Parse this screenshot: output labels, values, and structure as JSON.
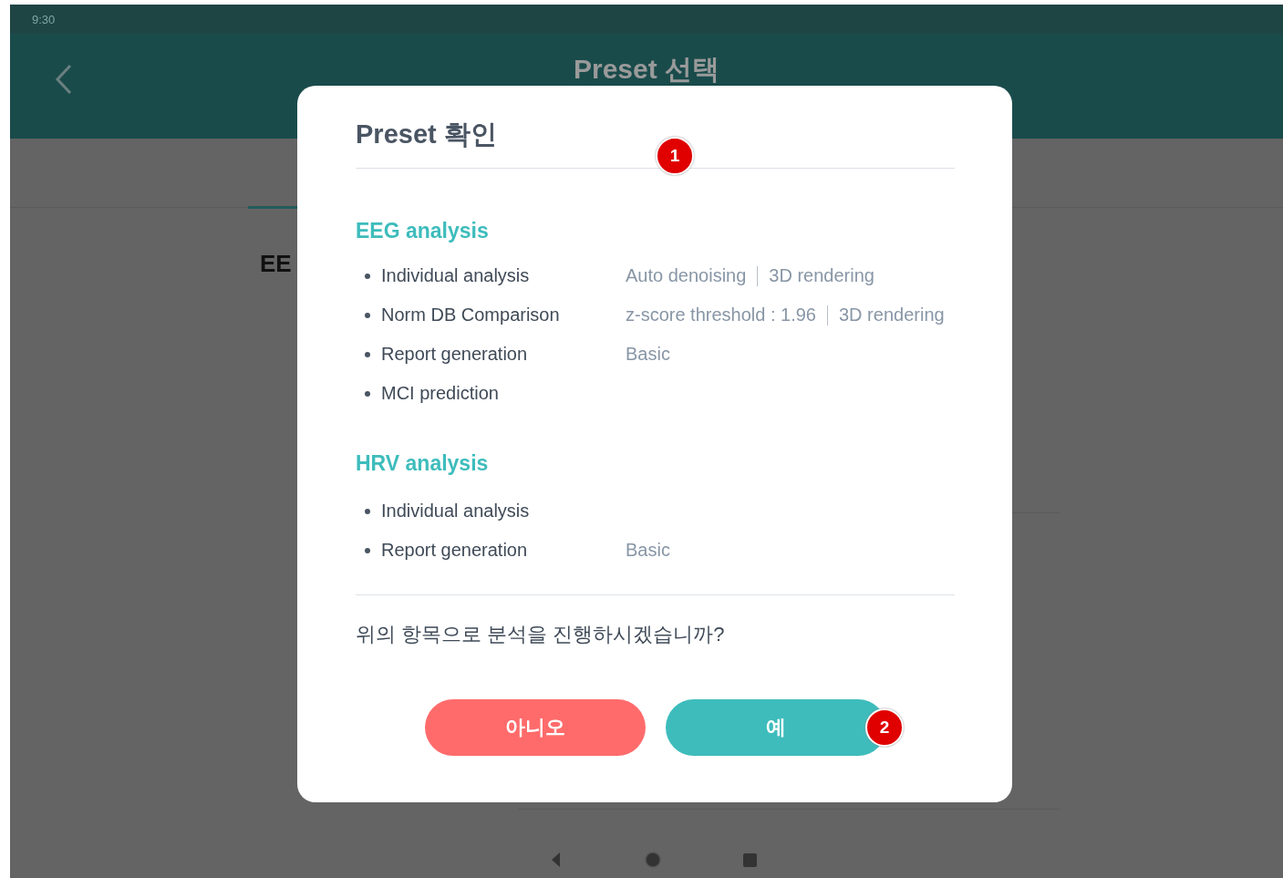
{
  "status_bar": {
    "time": "9:30"
  },
  "app_bar": {
    "title": "Preset 선택"
  },
  "page": {
    "heading": "EE"
  },
  "dialog": {
    "title": "Preset 확인",
    "sections": [
      {
        "title": "EEG analysis",
        "items": [
          {
            "label": "Individual analysis",
            "values": [
              "Auto denoising",
              "3D rendering"
            ]
          },
          {
            "label": "Norm DB Comparison",
            "values": [
              "z-score threshold : 1.96",
              "3D rendering"
            ]
          },
          {
            "label": "Report generation",
            "values": [
              "Basic"
            ]
          },
          {
            "label": "MCI prediction"
          }
        ]
      },
      {
        "title": "HRV analysis",
        "items": [
          {
            "label": "Individual analysis"
          },
          {
            "label": "Report generation",
            "values": [
              "Basic"
            ]
          }
        ]
      }
    ],
    "question": "위의 항목으로 분석을 진행하시겠습니까?",
    "buttons": [
      {
        "label": "아니오",
        "kind": "cancel"
      },
      {
        "label": "예",
        "kind": "confirm"
      }
    ]
  },
  "annotations": [
    {
      "label": "1"
    },
    {
      "label": "2"
    }
  ]
}
